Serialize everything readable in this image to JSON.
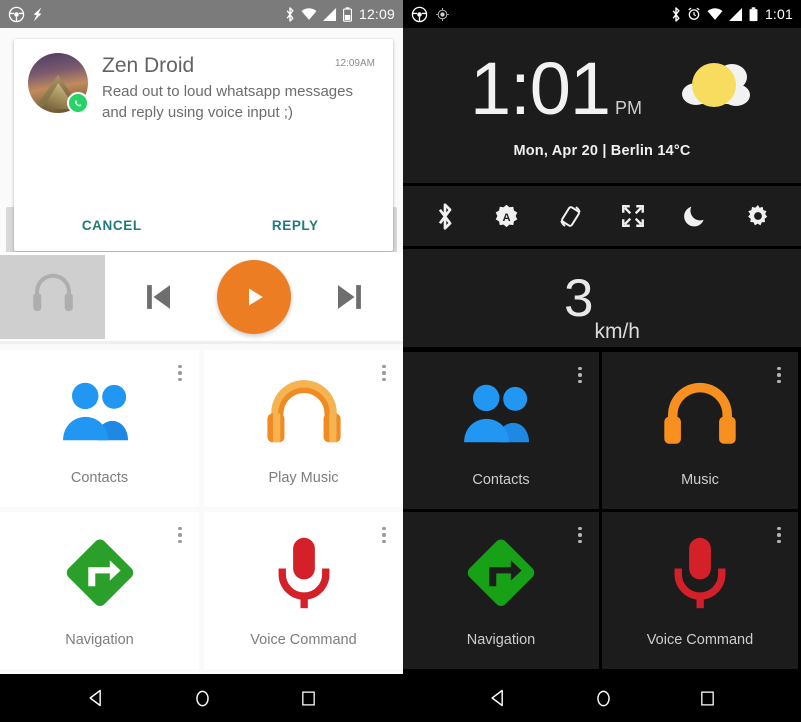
{
  "left_panel": {
    "theme": "light",
    "statusbar": {
      "time": "12:09",
      "icons": [
        "steering-wheel-icon",
        "flash-icon",
        "bluetooth-icon",
        "wifi-icon",
        "signal-icon",
        "battery-icon"
      ],
      "background": "#7b7b7b"
    },
    "notification": {
      "app_name": "Zen Droid",
      "time": "12:09AM",
      "message": "Read out to loud whatsapp messages and reply using voice input ;)",
      "badge": "whatsapp-icon",
      "actions": {
        "cancel": "CANCEL",
        "reply": "REPLY"
      },
      "action_color": "#1f7a7a"
    },
    "media": {
      "source_icon": "headphones-icon",
      "previous_label": "Previous",
      "play_label": "Play",
      "next_label": "Next",
      "play_color": "#ed7d22"
    },
    "tiles": [
      {
        "label": "Contacts",
        "icon": "contacts-icon",
        "color": "#2196f3"
      },
      {
        "label": "Play Music",
        "icon": "play-music-headphones-icon",
        "color": "#f29a30"
      },
      {
        "label": "Navigation",
        "icon": "navigation-arrow-icon",
        "color": "#2aa02a"
      },
      {
        "label": "Voice Command",
        "icon": "microphone-icon",
        "color": "#d32029"
      }
    ]
  },
  "right_panel": {
    "theme": "dark",
    "statusbar": {
      "time": "1:01",
      "icons": [
        "steering-wheel-icon",
        "gps-target-icon",
        "bluetooth-icon",
        "alarm-icon",
        "wifi-icon",
        "signal-icon",
        "battery-icon"
      ],
      "background": "#000000"
    },
    "clock": {
      "time": "1:01",
      "ampm": "PM",
      "subtitle": "Mon, Apr 20 | Berlin 14°C",
      "weather_icon": "sun-behind-cloud-icon",
      "sun_color": "#f7dc5f"
    },
    "toggles": [
      {
        "name": "bluetooth-toggle",
        "icon": "bluetooth-icon"
      },
      {
        "name": "auto-brightness-toggle",
        "icon": "brightness-auto-icon"
      },
      {
        "name": "auto-rotate-toggle",
        "icon": "screen-rotation-icon"
      },
      {
        "name": "fullscreen-toggle",
        "icon": "fullscreen-icon"
      },
      {
        "name": "night-mode-toggle",
        "icon": "moon-icon"
      },
      {
        "name": "settings-button",
        "icon": "gear-icon"
      }
    ],
    "speed": {
      "value": "3",
      "unit": "km/h"
    },
    "tiles": [
      {
        "label": "Contacts",
        "icon": "contacts-icon",
        "color": "#2196f3"
      },
      {
        "label": "Music",
        "icon": "headphones-icon",
        "color": "#f7901e"
      },
      {
        "label": "Navigation",
        "icon": "navigation-arrow-icon",
        "color": "#17a117"
      },
      {
        "label": "Voice Command",
        "icon": "microphone-icon",
        "color": "#d32029"
      }
    ]
  },
  "navbar": {
    "back_label": "Back",
    "home_label": "Home",
    "recents_label": "Recents"
  }
}
